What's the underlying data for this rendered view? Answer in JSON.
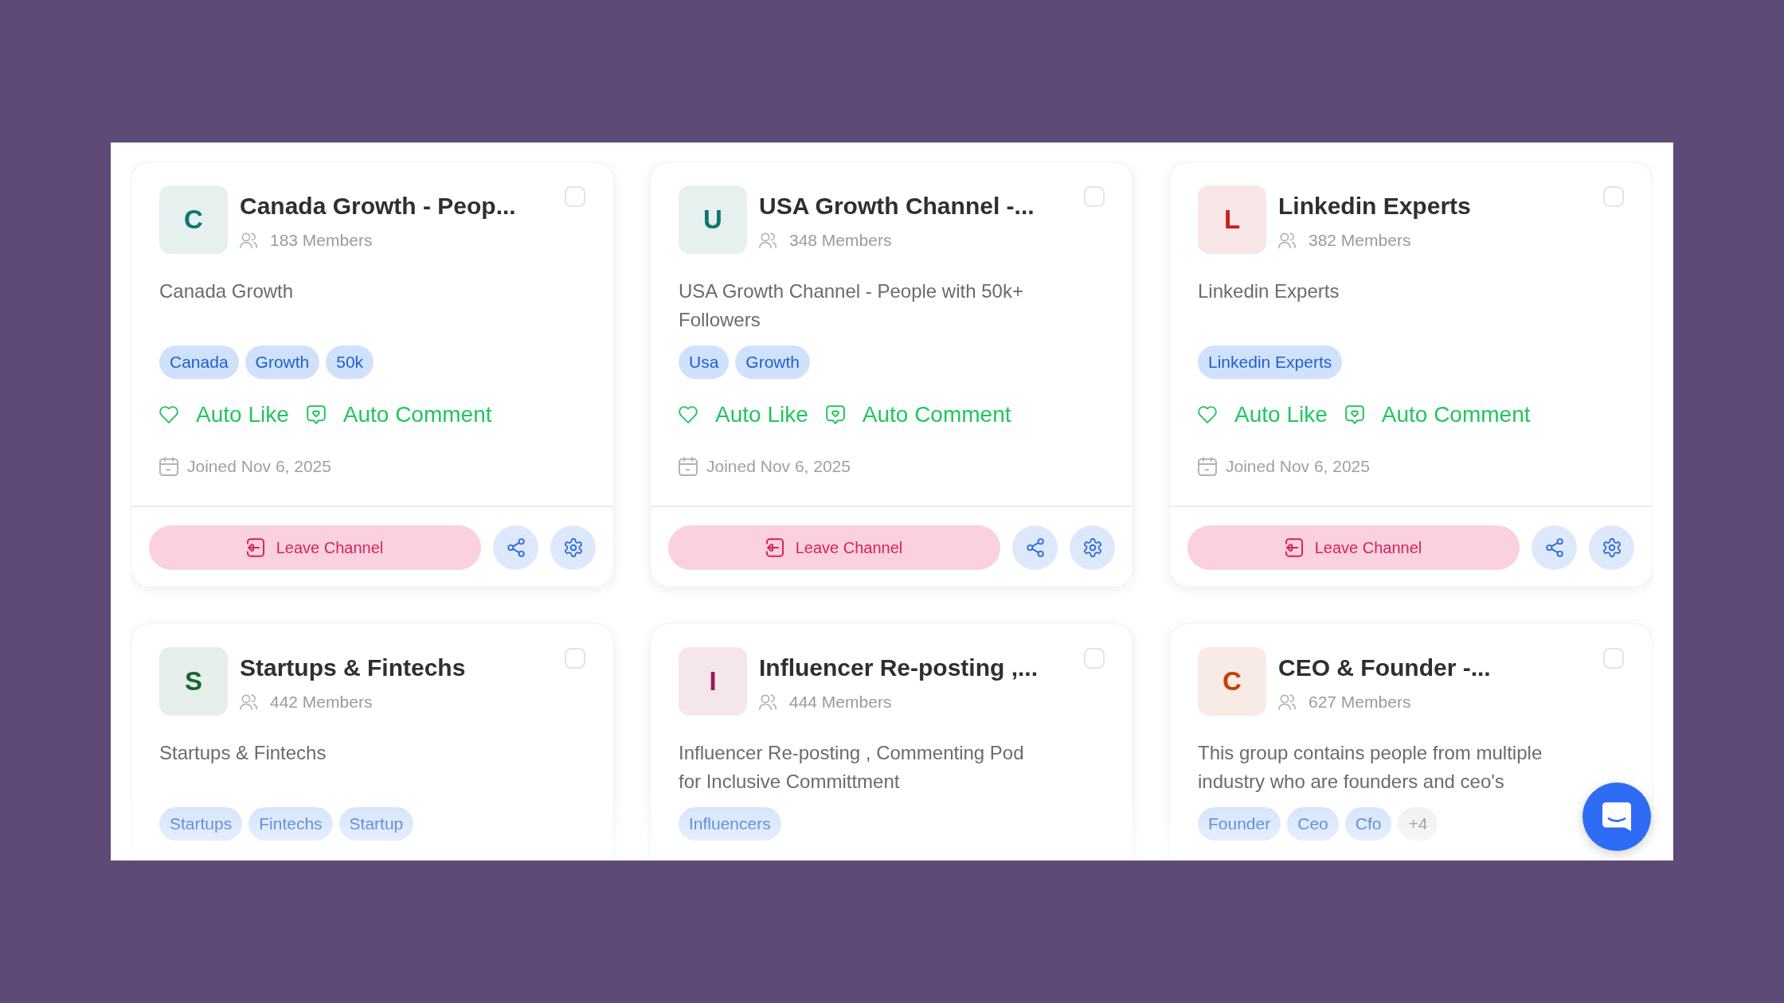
{
  "cards": [
    {
      "initial": "C",
      "color": "#0f766e",
      "title": "Canada Growth - Peop...",
      "checked": false,
      "members": "183 Members",
      "description": "Canada Growth",
      "tags": [
        {
          "label": "Canada",
          "kind": "tag"
        },
        {
          "label": "Growth",
          "kind": "tag"
        },
        {
          "label": "50k",
          "kind": "tag"
        }
      ],
      "features": [
        {
          "label": "Auto Like",
          "kind": "like",
          "on": true
        },
        {
          "label": "Auto Comment",
          "kind": "comment",
          "on": true
        }
      ],
      "joined": "Joined Nov 6, 2025",
      "leave_button": "Leave Channel"
    },
    {
      "initial": "U",
      "color": "#0f766e",
      "title": "USA Growth Channel -...",
      "checked": false,
      "members": "348 Members",
      "description": "USA Growth Channel - People with 50k+ Followers",
      "tags": [
        {
          "label": "Usa",
          "kind": "tag"
        },
        {
          "label": "Growth",
          "kind": "tag"
        }
      ],
      "features": [
        {
          "label": "Auto Like",
          "kind": "like",
          "on": true
        },
        {
          "label": "Auto Comment",
          "kind": "comment",
          "on": true
        }
      ],
      "joined": "Joined Nov 6, 2025",
      "leave_button": "Leave Channel"
    },
    {
      "initial": "L",
      "color": "#c81e1e",
      "title": "Linkedin Experts",
      "checked": false,
      "members": "382 Members",
      "description": "Linkedin Experts",
      "tags": [
        {
          "label": "Linkedin Experts",
          "kind": "tag"
        }
      ],
      "features": [
        {
          "label": "Auto Like",
          "kind": "like",
          "on": true
        },
        {
          "label": "Auto Comment",
          "kind": "comment",
          "on": true
        }
      ],
      "joined": "Joined Nov 6, 2025",
      "leave_button": "Leave Channel"
    },
    {
      "initial": "S",
      "color": "#166534",
      "title": "Startups & Fintechs",
      "checked": false,
      "members": "442 Members",
      "description": "Startups & Fintechs",
      "tags": [
        {
          "label": "Startups",
          "kind": "tag"
        },
        {
          "label": "Fintechs",
          "kind": "tag"
        },
        {
          "label": "Startup",
          "kind": "tag"
        }
      ]
    },
    {
      "initial": "I",
      "color": "#9d174d",
      "title": "Influencer Re-posting ,...",
      "checked": false,
      "members": "444 Members",
      "description": "Influencer Re-posting , Commenting Pod for Inclusive Committment",
      "tags": [
        {
          "label": "Influencers",
          "kind": "tag"
        }
      ]
    },
    {
      "initial": "C",
      "color": "#c2410c",
      "title": "CEO & Founder -...",
      "checked": false,
      "members": "627 Members",
      "description": "This group contains people from multiple industry who are founders and ceo's",
      "tags": [
        {
          "label": "Founder",
          "kind": "tag"
        },
        {
          "label": "Ceo",
          "kind": "tag"
        },
        {
          "label": "Cfo",
          "kind": "tag"
        },
        {
          "label": "+4",
          "kind": "more"
        }
      ]
    }
  ]
}
